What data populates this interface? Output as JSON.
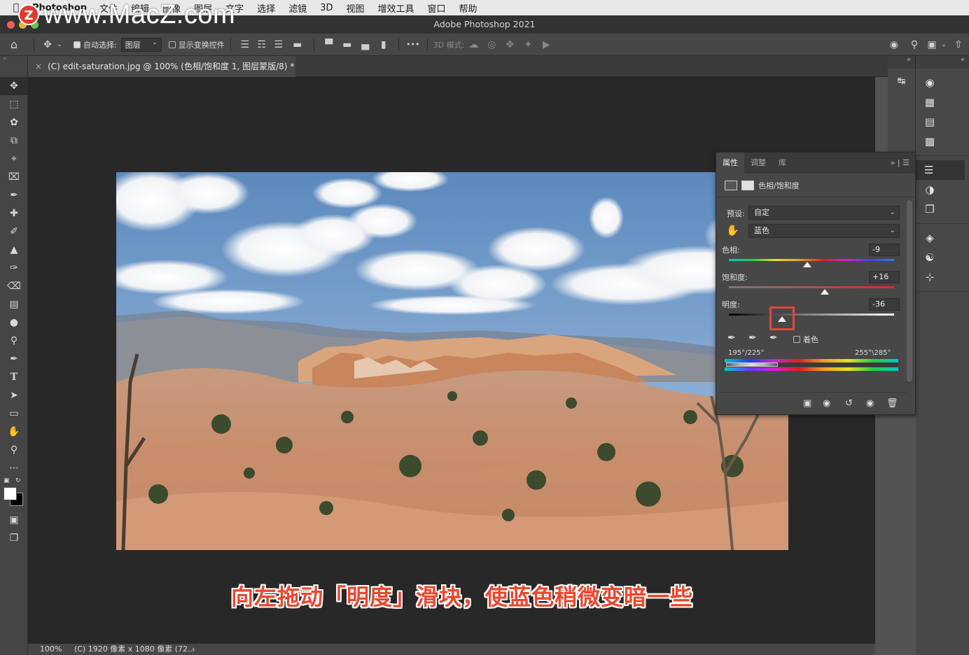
{
  "menubar": {
    "app_name": "Photoshop",
    "items": [
      "文件",
      "编辑",
      "图像",
      "图层",
      "文字",
      "选择",
      "滤镜",
      "3D",
      "视图",
      "增效工具",
      "窗口",
      "帮助"
    ]
  },
  "watermark": {
    "logo": "Z",
    "text": "www.MacZ.com"
  },
  "window": {
    "title": "Adobe Photoshop 2021"
  },
  "options_bar": {
    "auto_select_label": "自动选择:",
    "auto_select_checked": true,
    "auto_select_target": "图层",
    "show_transform_label": "显示变换控件",
    "show_transform_checked": false,
    "mode_3d_label": "3D 模式:",
    "more": "•••"
  },
  "document_tab": {
    "title": "(C) edit-saturation.jpg @ 100% (色相/饱和度 1, 图层蒙版/8) *"
  },
  "properties_panel": {
    "tabs": [
      "属性",
      "调整",
      "库"
    ],
    "active_tab": "属性",
    "adjustment_name": "色相/饱和度",
    "preset_label": "预设:",
    "preset_value": "自定",
    "channel_value": "蓝色",
    "hue_label": "色相:",
    "hue_value": "-9",
    "hue_level": -9,
    "saturation_label": "饱和度:",
    "saturation_value": "+16",
    "saturation_level": 16,
    "lightness_label": "明度:",
    "lightness_value": "-36",
    "lightness_level": -36,
    "colorize_label": "着色",
    "colorize_checked": false,
    "range_left": "195°/225°",
    "range_right": "255°\\285°"
  },
  "status_bar": {
    "zoom": "100%",
    "doc_info": "(C) 1920 像素 x 1080 像素 (72..."
  },
  "caption": "向左拖动「明度」滑块，使蓝色稍微变暗一些",
  "colors": {
    "accent_highlight": "#e4473c",
    "caption_color": "#e8482f"
  }
}
